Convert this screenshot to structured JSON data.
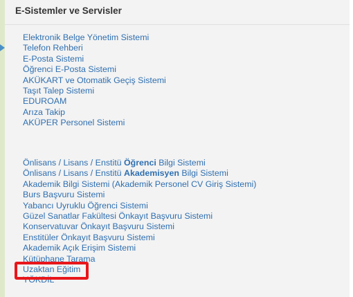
{
  "section": {
    "title": "E-Sistemler ve Servisler"
  },
  "group1": {
    "items": [
      "Elektronik Belge Yönetim Sistemi",
      "Telefon Rehberi",
      "E-Posta Sistemi",
      "Öğrenci E-Posta Sistemi",
      "AKÜKART ve Otomatik Geçiş Sistemi",
      "Taşıt Talep Sistemi",
      "EDUROAM",
      "Arıza Takip",
      "AKÜPER Personel Sistemi"
    ]
  },
  "group2": {
    "items": [
      {
        "pre": "Önlisans / Lisans / Enstitü ",
        "bold": "Öğrenci",
        "post": " Bilgi Sistemi"
      },
      {
        "pre": "Önlisans / Lisans / Enstitü ",
        "bold": "Akademisyen",
        "post": " Bilgi Sistemi"
      },
      {
        "pre": "Akademik Bilgi Sistemi (Akademik Personel CV Giriş Sistemi)"
      },
      {
        "pre": "Burs Başvuru Sistemi"
      },
      {
        "pre": "Yabancı Uyruklu Öğrenci Sistemi"
      },
      {
        "pre": "Güzel Sanatlar Fakültesi Önkayıt Başvuru Sistemi"
      },
      {
        "pre": "Konservatuvar Önkayıt Başvuru Sistemi"
      },
      {
        "pre": "Enstitüler Önkayıt Başvuru Sistemi"
      },
      {
        "pre": "Akademik Açık Erişim Sistemi"
      },
      {
        "pre": "Kütüphane Tarama"
      },
      {
        "pre": "Uzaktan Eğitim"
      },
      {
        "pre": "YÖKDİL"
      }
    ]
  },
  "colors": {
    "link": "#2f6fb0",
    "highlight": "#e8161b",
    "panel_bg": "#f3f3f3",
    "left_strip": "#dfe8c8"
  },
  "highlighted_item": "Uzaktan Eğitim",
  "marker_icon": "arrow-right-icon"
}
